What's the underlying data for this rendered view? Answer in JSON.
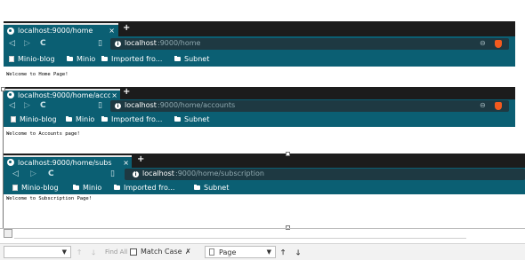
{
  "windows": [
    {
      "tab_title": "localhost:9000/home",
      "url_host": "localhost",
      "url_path": ":9000/home",
      "page_text": "Welcome to Home Page!"
    },
    {
      "tab_title": "localhost:9000/home/acco",
      "url_host": "localhost",
      "url_path": ":9000/home/accounts",
      "page_text": "Welcome to Accounts page!"
    },
    {
      "tab_title": "localhost:9000/home/subs",
      "url_host": "localhost",
      "url_path": ":9000/home/subscription",
      "page_text": "Welcome to Subscription Page!"
    }
  ],
  "bookmarks": [
    "Minio-blog",
    "Minio",
    "Imported fro...",
    "Subnet"
  ],
  "tab_close": "×",
  "new_tab": "+",
  "nav": {
    "back": "◁",
    "forward": "▷",
    "reload": "C",
    "bookmark": "▯"
  },
  "zoom_icon": "⊖",
  "findbar": {
    "find_all": "Find All",
    "match_case": "Match Case",
    "search_in": "Page"
  },
  "colors": {
    "tab": "#0b5f73",
    "titlebar": "#1c1c1c",
    "brave": "#f45a1e"
  }
}
